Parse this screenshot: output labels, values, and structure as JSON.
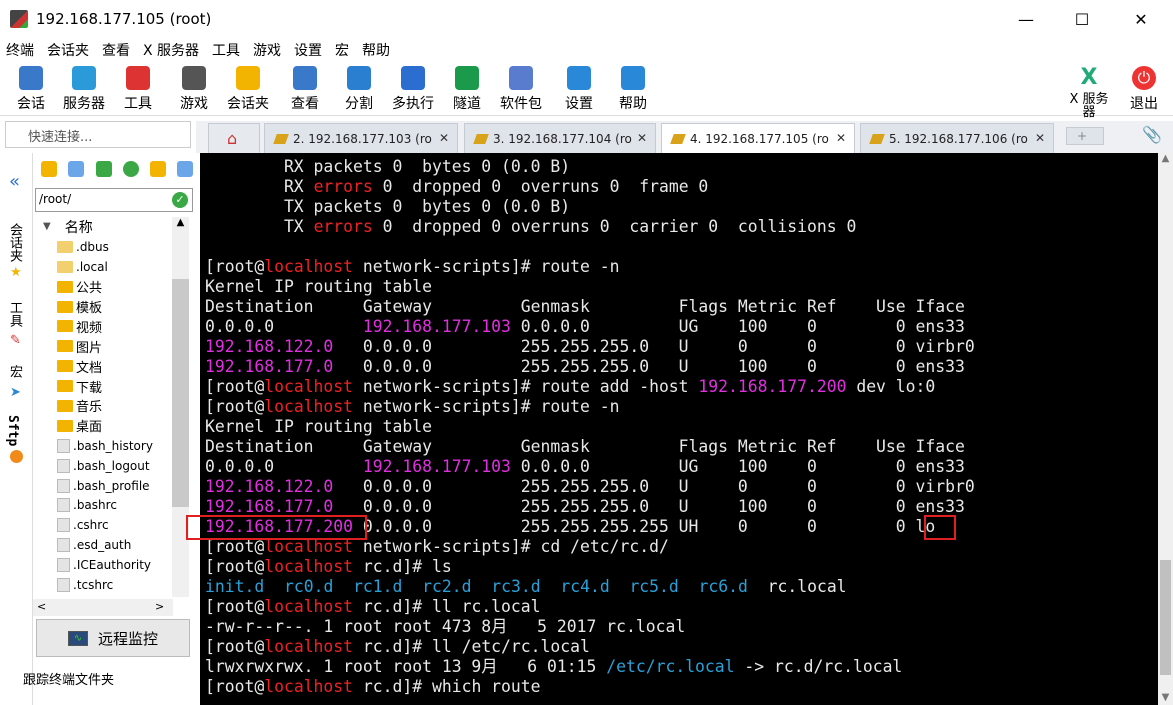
{
  "window": {
    "title": "192.168.177.105 (root)"
  },
  "menu": [
    "终端",
    "会话夹",
    "查看",
    "X 服务器",
    "工具",
    "游戏",
    "设置",
    "宏",
    "帮助"
  ],
  "toolbar": [
    {
      "label": "会话",
      "icon": "session-icon",
      "color": "#3a78c9"
    },
    {
      "label": "服务器",
      "icon": "servers-icon",
      "color": "#2b9ad8"
    },
    {
      "label": "工具",
      "icon": "tools-icon",
      "color": "#d33"
    },
    {
      "label": "游戏",
      "icon": "games-icon",
      "color": "#555"
    },
    {
      "label": "会话夹",
      "icon": "star-icon",
      "color": "#f2b400"
    },
    {
      "label": "查看",
      "icon": "view-icon",
      "color": "#3a78c9"
    },
    {
      "label": "分割",
      "icon": "split-icon",
      "color": "#2a7fd0"
    },
    {
      "label": "多执行",
      "icon": "multiexec-icon",
      "color": "#2b6ed0"
    },
    {
      "label": "隧道",
      "icon": "tunnel-icon",
      "color": "#1a9a4a"
    },
    {
      "label": "软件包",
      "icon": "packages-icon",
      "color": "#5a7ccf"
    },
    {
      "label": "设置",
      "icon": "settings-icon",
      "color": "#2a88d8"
    },
    {
      "label": "帮助",
      "icon": "help-icon",
      "color": "#2a88d8"
    }
  ],
  "toolbar_right": {
    "xserver": "X 服务\n器",
    "exit": "退出"
  },
  "quick_connect": {
    "placeholder": "快速连接..."
  },
  "tabs": [
    "2. 192.168.177.103 (ro",
    "3. 192.168.177.104 (ro",
    "4. 192.168.177.105 (ro",
    "5. 192.168.177.106 (ro"
  ],
  "side_tabs": [
    "会话夹",
    "工具",
    "宏",
    "Sftp"
  ],
  "filepanel": {
    "path": "/root/",
    "header": "名称",
    "items": [
      ".dbus",
      ".local",
      "公共",
      "模板",
      "视频",
      "图片",
      "文档",
      "下载",
      "音乐",
      "桌面",
      ".bash_history",
      ".bash_logout",
      ".bash_profile",
      ".bashrc",
      ".cshrc",
      ".esd_auth",
      ".ICEauthority",
      ".tcshrc"
    ],
    "remote_monitor": "远程监控",
    "follow_folder": "跟踪终端文件夹"
  },
  "terminal": {
    "lines": [
      [
        [
          "        RX packets 0  bytes 0 (0.0 B)",
          ""
        ]
      ],
      [
        [
          "        RX ",
          ""
        ],
        [
          "errors",
          "r"
        ],
        [
          " 0  dropped 0  overruns 0  frame 0",
          ""
        ]
      ],
      [
        [
          "        TX packets 0  bytes 0 (0.0 B)",
          ""
        ]
      ],
      [
        [
          "        TX ",
          ""
        ],
        [
          "errors",
          "r"
        ],
        [
          " 0  dropped 0 overruns 0  carrier 0  collisions 0",
          ""
        ]
      ],
      [
        [
          "",
          ""
        ]
      ],
      [
        [
          "[root@",
          ""
        ],
        [
          "localhost",
          "r"
        ],
        [
          " network-scripts]# route -n",
          ""
        ]
      ],
      [
        [
          "Kernel IP routing table",
          ""
        ]
      ],
      [
        [
          "Destination     Gateway         Genmask         Flags Metric Ref    Use Iface",
          ""
        ]
      ],
      [
        [
          "0.0.0.0         ",
          ""
        ],
        [
          "192.168.177.103",
          "m"
        ],
        [
          " 0.0.0.0         UG    100    0        0 ens33",
          ""
        ]
      ],
      [
        [
          "192.168.122.0",
          "m"
        ],
        [
          "   0.0.0.0         255.255.255.0   U     0      0        0 virbr0",
          ""
        ]
      ],
      [
        [
          "192.168.177.0",
          "m"
        ],
        [
          "   0.0.0.0         255.255.255.0   U     100    0        0 ens33",
          ""
        ]
      ],
      [
        [
          "[root@",
          ""
        ],
        [
          "localhost",
          "r"
        ],
        [
          " network-scripts]# route add -host ",
          ""
        ],
        [
          "192.168.177.200",
          "m"
        ],
        [
          " dev lo:0",
          ""
        ]
      ],
      [
        [
          "[root@",
          ""
        ],
        [
          "localhost",
          "r"
        ],
        [
          " network-scripts]# route -n",
          ""
        ]
      ],
      [
        [
          "Kernel IP routing table",
          ""
        ]
      ],
      [
        [
          "Destination     Gateway         Genmask         Flags Metric Ref    Use Iface",
          ""
        ]
      ],
      [
        [
          "0.0.0.0         ",
          ""
        ],
        [
          "192.168.177.103",
          "m"
        ],
        [
          " 0.0.0.0         UG    100    0        0 ens33",
          ""
        ]
      ],
      [
        [
          "192.168.122.0",
          "m"
        ],
        [
          "   0.0.0.0         255.255.255.0   U     0      0        0 virbr0",
          ""
        ]
      ],
      [
        [
          "192.168.177.0",
          "m"
        ],
        [
          "   0.0.0.0         255.255.255.0   U     100    0        0 ens33",
          ""
        ]
      ],
      [
        [
          "192.168.177.200",
          "m"
        ],
        [
          " 0.0.0.0         255.255.255.255 UH    0      0        0 lo",
          ""
        ]
      ],
      [
        [
          "[root@",
          ""
        ],
        [
          "localhost",
          "r"
        ],
        [
          " network-scripts]# cd /etc/rc.d/",
          ""
        ]
      ],
      [
        [
          "[root@",
          ""
        ],
        [
          "localhost",
          "r"
        ],
        [
          " rc.d]# ls",
          ""
        ]
      ],
      [
        [
          "init.d",
          "c"
        ],
        [
          "  ",
          ""
        ],
        [
          "rc0.d",
          "c"
        ],
        [
          "  ",
          ""
        ],
        [
          "rc1.d",
          "c"
        ],
        [
          "  ",
          ""
        ],
        [
          "rc2.d",
          "c"
        ],
        [
          "  ",
          ""
        ],
        [
          "rc3.d",
          "c"
        ],
        [
          "  ",
          ""
        ],
        [
          "rc4.d",
          "c"
        ],
        [
          "  ",
          ""
        ],
        [
          "rc5.d",
          "c"
        ],
        [
          "  ",
          ""
        ],
        [
          "rc6.d",
          "c"
        ],
        [
          "  rc.local",
          ""
        ]
      ],
      [
        [
          "[root@",
          ""
        ],
        [
          "localhost",
          "r"
        ],
        [
          " rc.d]# ll rc.local",
          ""
        ]
      ],
      [
        [
          "-rw-r--r--. 1 root root 473 8月   5 2017 rc.local",
          ""
        ]
      ],
      [
        [
          "[root@",
          ""
        ],
        [
          "localhost",
          "r"
        ],
        [
          " rc.d]# ll /etc/rc.local",
          ""
        ]
      ],
      [
        [
          "lrwxrwxrwx. 1 root root 13 9月   6 01:15 ",
          ""
        ],
        [
          "/etc/rc.local",
          "c"
        ],
        [
          " -> rc.d/rc.local",
          ""
        ]
      ],
      [
        [
          "[root@",
          ""
        ],
        [
          "localhost",
          "r"
        ],
        [
          " rc.d]# which route",
          ""
        ]
      ]
    ]
  }
}
